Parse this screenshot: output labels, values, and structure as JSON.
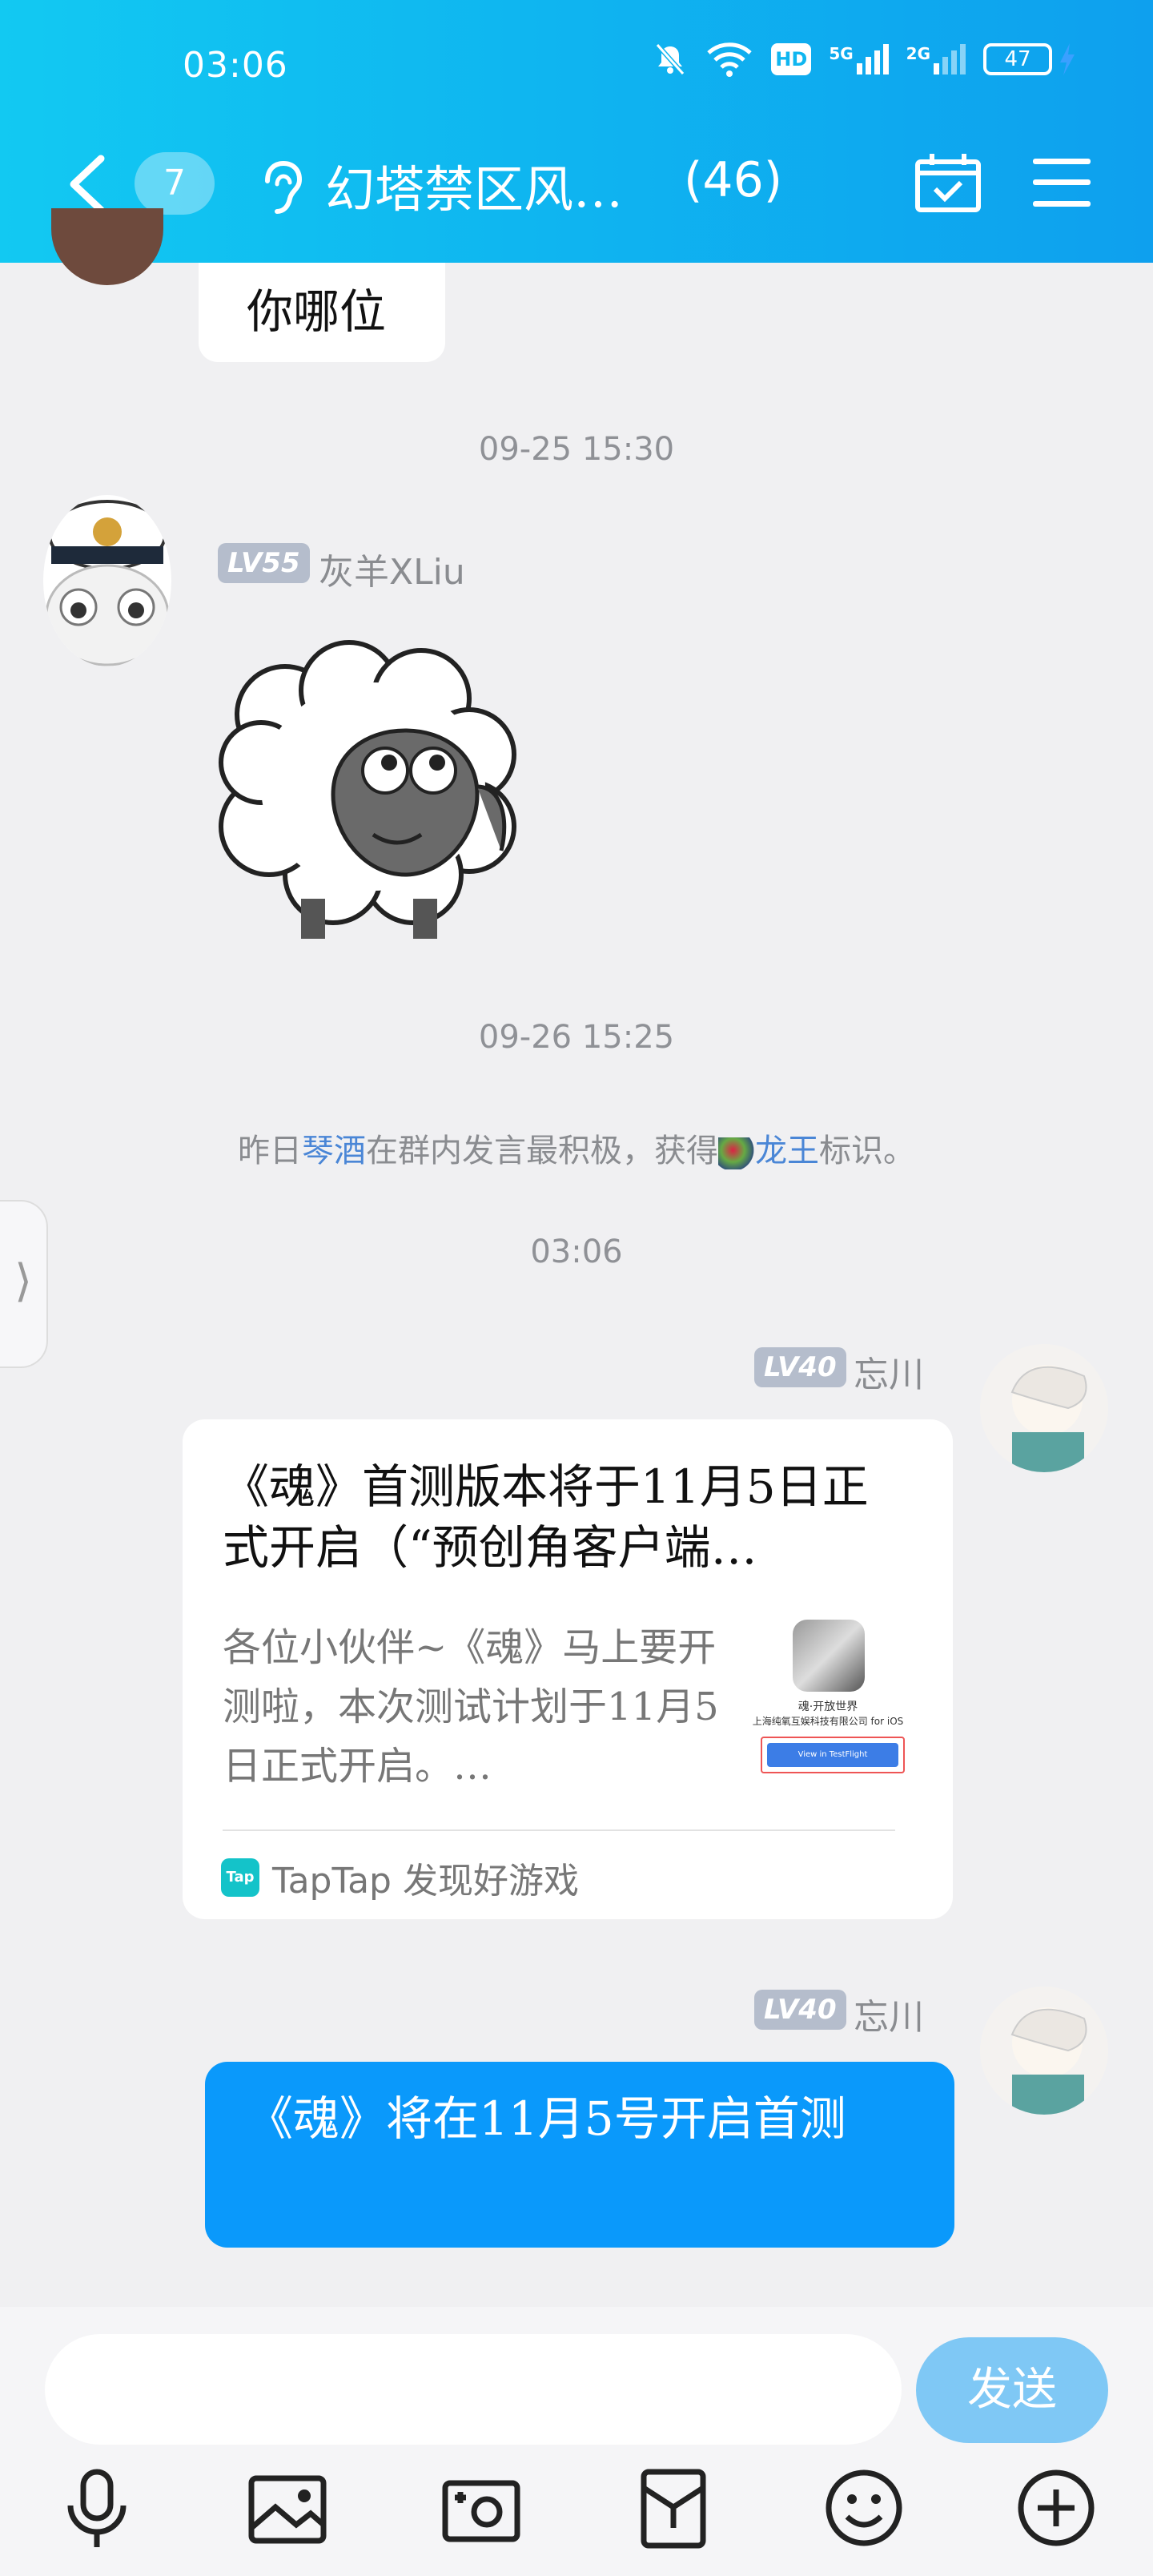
{
  "status_bar": {
    "time": "03:06",
    "battery": "47",
    "net1": "5G",
    "net2": "2G",
    "hd": "HD"
  },
  "header": {
    "unread_count": "7",
    "title": "幻塔禁区风…",
    "member_count": "(46)"
  },
  "messages": {
    "prev_bubble_text": "你哪位",
    "time1": "09-25 15:30",
    "msg1": {
      "level": "LV55",
      "nick": "灰羊XLiu",
      "sticker": "sheep"
    },
    "time2": "09-26 15:25",
    "system": {
      "prefix": "昨日",
      "name": "琴酒",
      "mid": "在群内发言最积极，获得",
      "badge": "龙王",
      "suffix": "标识。"
    },
    "time3": "03:06",
    "msg2": {
      "level": "LV40",
      "nick": "忘川",
      "card_title": "《魂》首测版本将于11月5日正式开启（“预创角客户端…",
      "card_desc": "各位小伙伴~《魂》马上要开测啦，本次测试计划于11月5日正式开启。…",
      "card_source": "TapTap 发现好游戏",
      "tap_logo": "Tap",
      "thumb_line1": "魂·开放世界",
      "thumb_line2": "上海纯氧互娱科技有限公司 for iOS",
      "thumb_button": "View in TestFlight"
    },
    "msg3": {
      "level": "LV40",
      "nick": "忘川",
      "text": "《魂》将在11月5号开启首测"
    }
  },
  "input_bar": {
    "placeholder": "",
    "send_label": "发送"
  },
  "toolbar": [
    "mic-icon",
    "image-icon",
    "camera-icon",
    "red-packet-icon",
    "emoji-icon",
    "plus-icon"
  ],
  "colors": {
    "header": "#0fb6f0",
    "bubble_blue": "#0a99fb",
    "link": "#4a86d6",
    "send": "#7fc8f5"
  }
}
